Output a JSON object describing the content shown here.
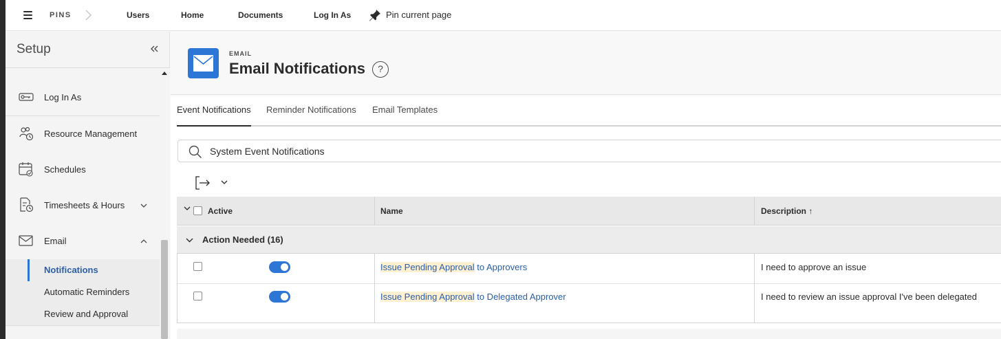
{
  "topbar": {
    "pins_label": "PINS",
    "pins": [
      "Users",
      "Home",
      "Documents",
      "Log In As"
    ],
    "pin_current_label": "Pin current page"
  },
  "sidebar": {
    "title": "Setup",
    "items": [
      {
        "label": "Log In As",
        "icon": "key-icon"
      },
      {
        "label": "Resource Management",
        "icon": "people-clock-icon"
      },
      {
        "label": "Schedules",
        "icon": "calendar-icon"
      },
      {
        "label": "Timesheets & Hours",
        "icon": "timesheet-icon",
        "expandable": true,
        "expanded": false
      },
      {
        "label": "Email",
        "icon": "envelope-icon",
        "expandable": true,
        "expanded": true
      }
    ],
    "email_subitems": [
      {
        "label": "Notifications",
        "active": true
      },
      {
        "label": "Automatic Reminders",
        "active": false
      },
      {
        "label": "Review and Approval",
        "active": false
      }
    ]
  },
  "page": {
    "eyebrow": "EMAIL",
    "title": "Email Notifications",
    "help_glyph": "?"
  },
  "tabs": [
    {
      "label": "Event Notifications",
      "active": true
    },
    {
      "label": "Reminder Notifications",
      "active": false
    },
    {
      "label": "Email Templates",
      "active": false
    }
  ],
  "search": {
    "value": "System Event Notifications"
  },
  "table": {
    "columns": {
      "active": "Active",
      "name": "Name",
      "description": "Description ↑"
    },
    "group": {
      "label": "Action Needed (16)"
    },
    "rows": [
      {
        "active": true,
        "name_highlight": "Issue Pending Approval",
        "name_rest": " to Approvers",
        "description": "I need to approve an issue"
      },
      {
        "active": true,
        "name_highlight": "Issue Pending Approval",
        "name_rest": " to Delegated Approver",
        "description": "I need to review an issue approval I've been delegated"
      }
    ]
  },
  "colors": {
    "accent": "#2e76d6",
    "link": "#2b5dab",
    "highlight": "#fdf1d2"
  }
}
